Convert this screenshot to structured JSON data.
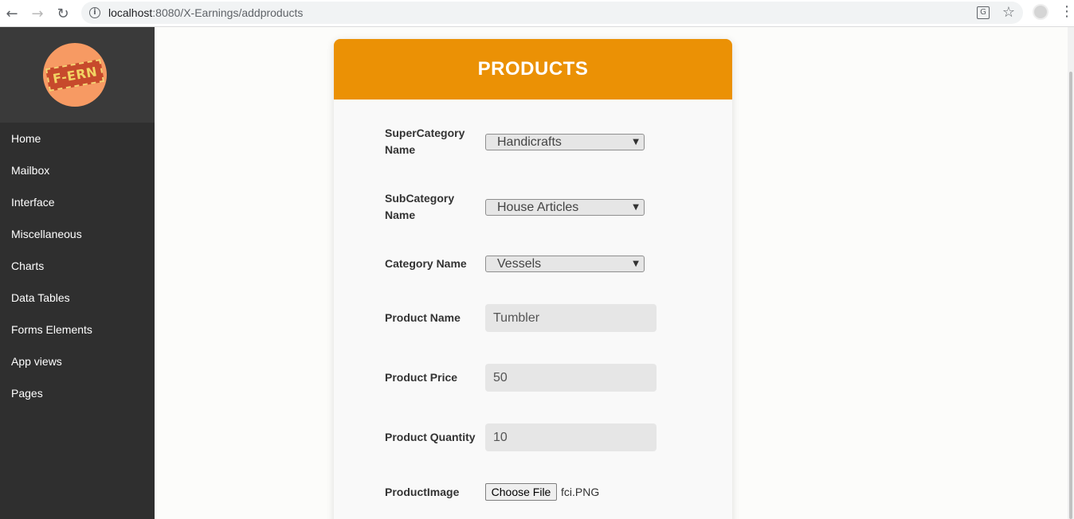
{
  "browser": {
    "url_host": "localhost",
    "url_path": ":8080/X-Earnings/addproducts",
    "back_glyph": "←",
    "forward_glyph": "→",
    "reload_glyph": "↻",
    "info_glyph": "i",
    "translate_glyph": "G",
    "star_glyph": "☆",
    "menu_glyph": "⋮"
  },
  "sidebar": {
    "logo_text": "F-ERN",
    "items": [
      {
        "label": "Home"
      },
      {
        "label": "Mailbox"
      },
      {
        "label": "Interface"
      },
      {
        "label": "Miscellaneous"
      },
      {
        "label": "Charts"
      },
      {
        "label": "Data Tables"
      },
      {
        "label": "Forms Elements"
      },
      {
        "label": "App views"
      },
      {
        "label": "Pages"
      }
    ]
  },
  "form": {
    "title": "PRODUCTS",
    "supercategory": {
      "label_line1": "SuperCategory",
      "label_line2": "Name",
      "value": "Handicrafts"
    },
    "subcategory": {
      "label_line1": "SubCategory",
      "label_line2": "Name",
      "value": "House Articles"
    },
    "category": {
      "label": "Category Name",
      "value": "Vessels"
    },
    "product_name": {
      "label": "Product Name",
      "value": "Tumbler"
    },
    "product_price": {
      "label": "Product Price",
      "value": "50"
    },
    "product_quantity": {
      "label": "Product Quantity",
      "value": "10"
    },
    "product_image": {
      "label": "ProductImage",
      "button_label": "Choose File",
      "file_name": "fci.PNG"
    },
    "select_arrow": "▼"
  },
  "colors": {
    "header_orange": "#eb9105",
    "sidebar_bg": "#2f2f2f",
    "logo_bg": "#f79a63"
  }
}
